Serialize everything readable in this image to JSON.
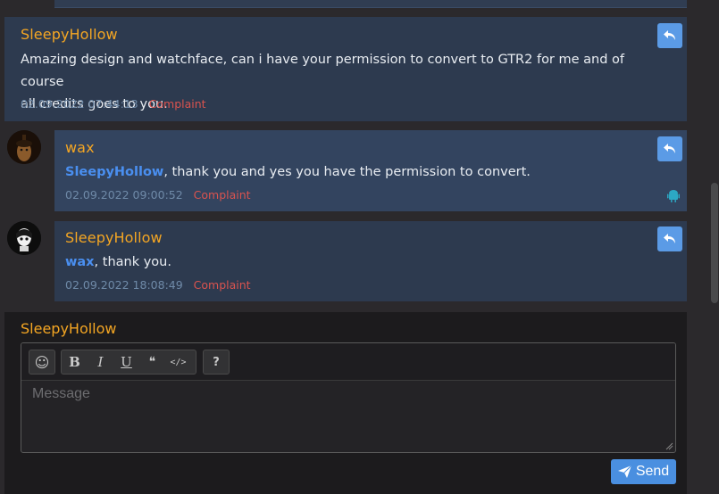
{
  "comments": [
    {
      "author": "SleepyHollow",
      "text_line1": "Amazing design and watchface, can i have your permission to convert to GTR2 for me and of course",
      "text_line2": "all credits goes to you.",
      "timestamp": "02.09.2022 07:44:13",
      "complaint": "Complaint"
    },
    {
      "author": "wax",
      "mention": "SleepyHollow",
      "text": ", thank you and yes you have the permission to convert.",
      "timestamp": "02.09.2022 09:00:52",
      "complaint": "Complaint",
      "device_icon": "android-icon"
    },
    {
      "author": "SleepyHollow",
      "mention": "wax",
      "text": ", thank you.",
      "timestamp": "02.09.2022 18:08:49",
      "complaint": "Complaint"
    }
  ],
  "reply_form": {
    "author": "SleepyHollow",
    "toolbar": {
      "emoji": "☺",
      "bold": "B",
      "italic": "I",
      "underline": "U",
      "quote": "❝",
      "code": "</>",
      "help": "?"
    },
    "placeholder": "Message",
    "send_label": "Send"
  },
  "colors": {
    "author": "#f4a623",
    "mention": "#4a8ff0",
    "complaint": "#d9534f",
    "reply_button": "#5b9be6",
    "send_button": "#4a8fe0"
  }
}
